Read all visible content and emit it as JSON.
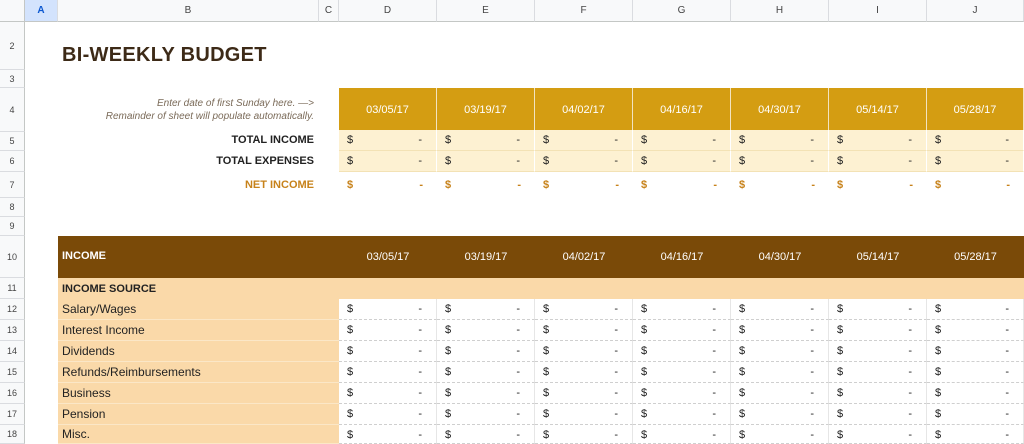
{
  "columns": [
    "A",
    "B",
    "C",
    "D",
    "E",
    "F",
    "G",
    "H",
    "I",
    "J"
  ],
  "selected_column": "A",
  "rows": [
    "2",
    "3",
    "4",
    "5",
    "6",
    "7",
    "8",
    "9",
    "10",
    "11",
    "12",
    "13",
    "14",
    "15",
    "16",
    "17",
    "18"
  ],
  "title": "BI-WEEKLY BUDGET",
  "note_line1": "Enter date of first Sunday here. —>",
  "note_line2": "Remainder of sheet will populate automatically.",
  "dates": [
    "03/05/17",
    "03/19/17",
    "04/02/17",
    "04/16/17",
    "04/30/17",
    "05/14/17",
    "05/28/17"
  ],
  "summary": {
    "total_income": "TOTAL INCOME",
    "total_expenses": "TOTAL EXPENSES",
    "net_income": "NET INCOME"
  },
  "currency": "$",
  "empty_value": "-",
  "income": {
    "header": "INCOME",
    "source_header": "INCOME SOURCE",
    "items": [
      "Salary/Wages",
      "Interest Income",
      "Dividends",
      "Refunds/Reimbursements",
      "Business",
      "Pension",
      "Misc."
    ]
  },
  "colors": {
    "date_header_bg": "#d49d12",
    "summary_bg": "#fdf1d2",
    "net_income_text": "#c7821a",
    "income_banner_bg": "#7a4a08",
    "label_bg": "#fad9a9",
    "title_text": "#3d2a17"
  }
}
